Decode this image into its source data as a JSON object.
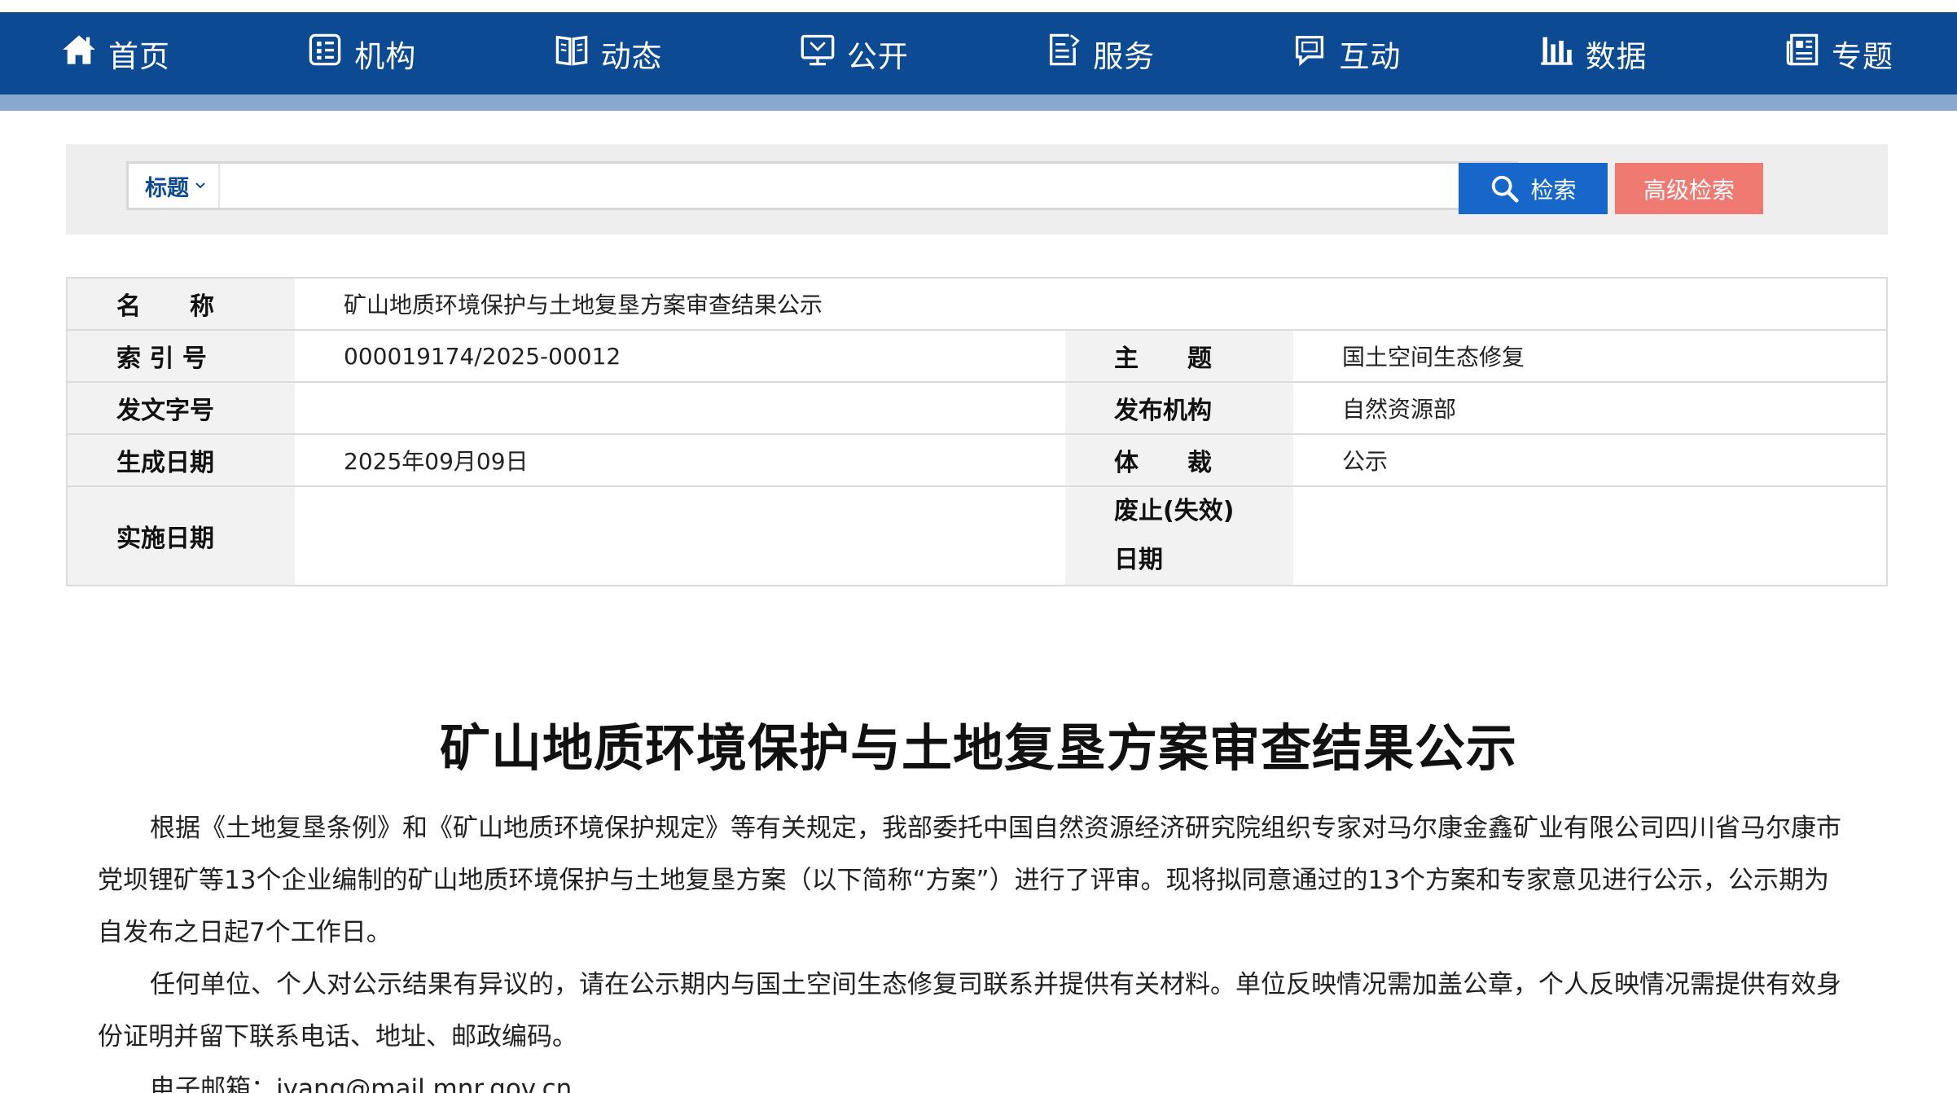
{
  "nav": {
    "items": [
      {
        "label": "首页",
        "icon": "home-icon"
      },
      {
        "label": "机构",
        "icon": "organization-icon"
      },
      {
        "label": "动态",
        "icon": "book-icon"
      },
      {
        "label": "公开",
        "icon": "monitor-icon"
      },
      {
        "label": "服务",
        "icon": "edit-document-icon"
      },
      {
        "label": "互动",
        "icon": "chat-icon"
      },
      {
        "label": "数据",
        "icon": "bar-chart-icon"
      },
      {
        "label": "专题",
        "icon": "newspaper-icon"
      }
    ]
  },
  "search": {
    "scope_label": "标题",
    "query": "",
    "search_button": "检索",
    "advanced_button": "高级检索"
  },
  "info": {
    "name_label": "名　　称",
    "name_value": "矿山地质环境保护与土地复垦方案审查结果公示",
    "index_label": "索 引 号",
    "index_value": "000019174/2025-00012",
    "topic_label": "主　　题",
    "topic_value": "国土空间生态修复",
    "doc_no_label": "发文字号",
    "doc_no_value": "",
    "issuer_label": "发布机构",
    "issuer_value": "自然资源部",
    "created_label": "生成日期",
    "created_value": "2025年09月09日",
    "genre_label": "体　　裁",
    "genre_value": "公示",
    "effective_label": "实施日期",
    "effective_value": "",
    "repeal_label_1": "废止(失效)",
    "repeal_label_2": "日期",
    "repeal_value": ""
  },
  "article": {
    "title": "矿山地质环境保护与土地复垦方案审查结果公示",
    "p1": "根据《土地复垦条例》和《矿山地质环境保护规定》等有关规定，我部委托中国自然资源经济研究院组织专家对马尔康金鑫矿业有限公司四川省马尔康市党坝锂矿等13个企业编制的矿山地质环境保护与土地复垦方案（以下简称“方案”）进行了评审。现将拟同意通过的13个方案和专家意见进行公示，公示期为自发布之日起7个工作日。",
    "p2": "任何单位、个人对公示结果有异议的，请在公示期内与国土空间生态修复司联系并提供有关材料。单位反映情况需加盖公章，个人反映情况需提供有效身份证明并留下联系电话、地址、邮政编码。",
    "p3": "电子邮箱：jyang@mail.mnr.gov.cn"
  }
}
